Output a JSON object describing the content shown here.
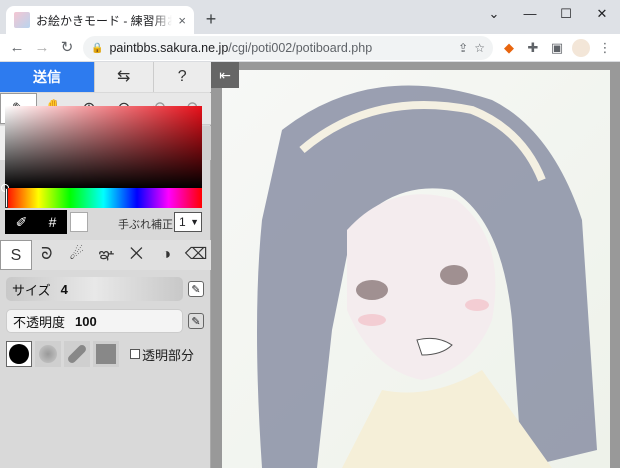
{
  "browser": {
    "tab_title": "お絵かきモード - 練習用お絵かき掲示板",
    "tab_close": "×",
    "new_tab": "+",
    "win_minimize": "⌄",
    "win_min": "—",
    "win_max": "☐",
    "win_close": "✕",
    "url_domain": "paintbbs.sakura.ne.jp",
    "url_path": "/cgi/poti002/potiboard.php"
  },
  "toolbar": {
    "send_label": "送信",
    "swap_icon": "⇆",
    "help_icon": "?"
  },
  "tabs": {
    "edit_label": "編集",
    "more_icon": "⋮"
  },
  "color": {
    "current": "#000000",
    "secondary": "#ffffff",
    "hex_symbol": "#",
    "stabilizer_label": "手ぶれ補正",
    "stabilizer_value": "1"
  },
  "brush": {
    "size_label": "サイズ",
    "size_value": "4",
    "opacity_label": "不透明度",
    "opacity_value": "100",
    "transparent_label": "透明部分"
  },
  "canvas": {
    "collapse_icon": "⇤"
  }
}
